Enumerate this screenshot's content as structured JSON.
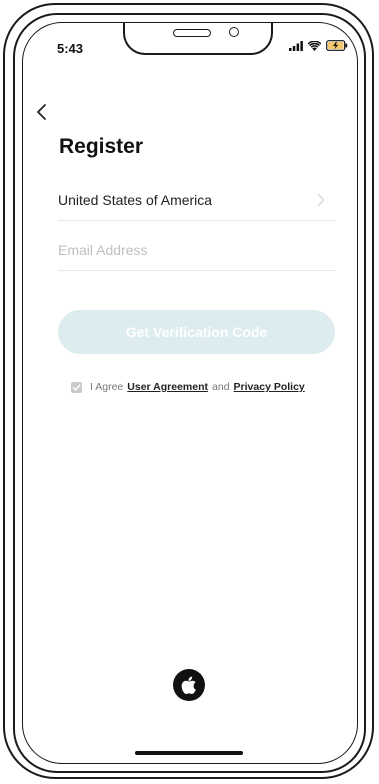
{
  "status": {
    "time": "5:43"
  },
  "page": {
    "title": "Register",
    "country": "United States of America",
    "email_placeholder": "Email Address",
    "email_value": "",
    "verify_button": "Get Verification Code",
    "agree_prefix": "I Agree",
    "user_agreement": "User Agreement",
    "and_text": "and",
    "privacy_policy": "Privacy Policy",
    "agree_checked": true
  },
  "colors": {
    "button_bg": "#dcecef",
    "checkbox": "#c9c9c9",
    "text": "#111111"
  },
  "icons": [
    "back-arrow-icon",
    "chevron-right-icon",
    "check-icon",
    "apple-logo-icon",
    "signal-icon",
    "wifi-icon",
    "battery-icon"
  ]
}
